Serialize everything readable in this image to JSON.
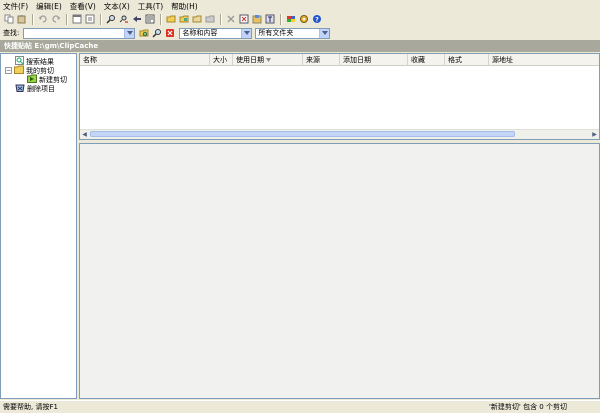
{
  "menu": [
    "文件(F)",
    "编辑(E)",
    "查看(V)",
    "文本(X)",
    "工具(T)",
    "帮助(H)"
  ],
  "find": {
    "label": "查找:",
    "query": "",
    "scope": "名称和内容",
    "folder": "所有文件夹"
  },
  "path": "快捷贴帖  E:\\gm\\ClipCache",
  "tree": {
    "search": "搜索结果",
    "my_clips": "我的剪切",
    "new_clip": "新建剪切",
    "deleted": "删除项目"
  },
  "columns": [
    "名称",
    "大小",
    "使用日期",
    "来源",
    "添加日期",
    "收藏",
    "格式",
    "源地址"
  ],
  "status": {
    "help": "需要帮助, 请按F1",
    "folder": "'新建剪切' 包含 0 个剪切"
  },
  "colors": {
    "accent": "#7f9db9",
    "path_bar": "#a8a89c",
    "chrome": "#ece9d8"
  }
}
